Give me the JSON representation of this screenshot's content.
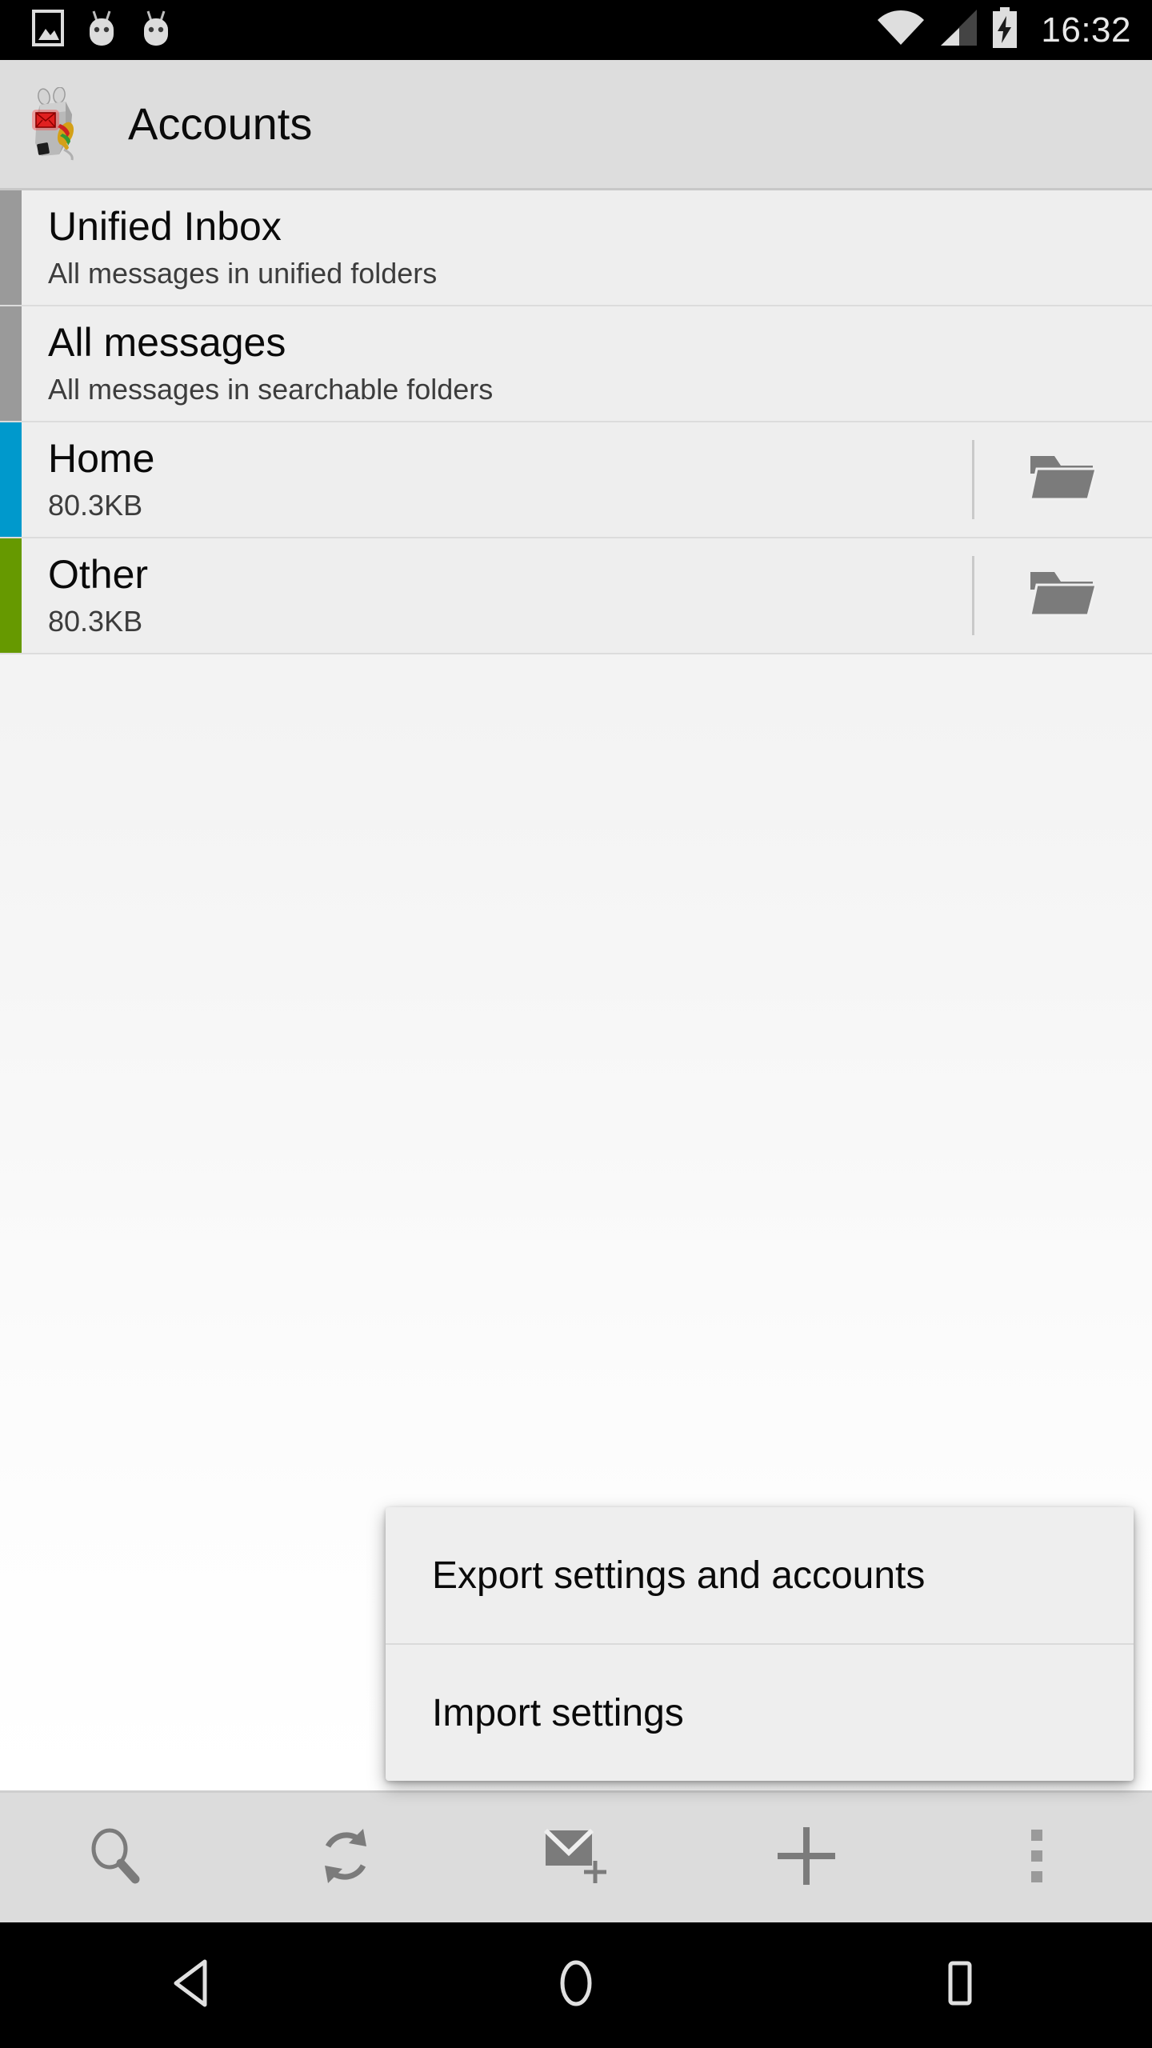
{
  "status_bar": {
    "time": "16:32",
    "icons": [
      "image-icon",
      "android-head-icon",
      "android-head-icon",
      "wifi-icon",
      "cell-signal-icon",
      "battery-charging-icon"
    ]
  },
  "action_bar": {
    "title": "Accounts",
    "logo_icon": "k9-mail-logo-icon"
  },
  "accounts": [
    {
      "name": "Unified Inbox",
      "subtitle": "All messages in unified folders",
      "stripe_color": "#9a9a9a",
      "has_folder_icon": false
    },
    {
      "name": "All messages",
      "subtitle": "All messages in searchable folders",
      "stripe_color": "#9a9a9a",
      "has_folder_icon": false
    },
    {
      "name": "Home",
      "subtitle": "80.3KB",
      "stripe_color": "#0099cc",
      "has_folder_icon": true
    },
    {
      "name": "Other",
      "subtitle": "80.3KB",
      "stripe_color": "#669900",
      "has_folder_icon": true
    }
  ],
  "popup_menu": {
    "items": [
      {
        "label": "Export settings and accounts"
      },
      {
        "label": "Import settings"
      }
    ]
  },
  "bottom_toolbar": {
    "buttons": [
      {
        "name": "search-icon",
        "label": "Search"
      },
      {
        "name": "refresh-icon",
        "label": "Check mail"
      },
      {
        "name": "compose-mail-icon",
        "label": "Compose"
      },
      {
        "name": "plus-icon",
        "label": "Add account"
      },
      {
        "name": "overflow-menu-icon",
        "label": "More options"
      }
    ]
  },
  "nav_bar": {
    "buttons": [
      {
        "name": "back-icon",
        "label": "Back"
      },
      {
        "name": "home-icon",
        "label": "Home"
      },
      {
        "name": "recents-icon",
        "label": "Recents"
      }
    ]
  },
  "colors": {
    "status_bar_bg": "#000000",
    "action_bar_bg": "#dddddd",
    "list_row_bg": "#eeeeee",
    "toolbar_bg": "#dcdcdc",
    "icon_gray": "#7b7b7b",
    "accent_blue": "#0099cc",
    "accent_green": "#669900"
  }
}
